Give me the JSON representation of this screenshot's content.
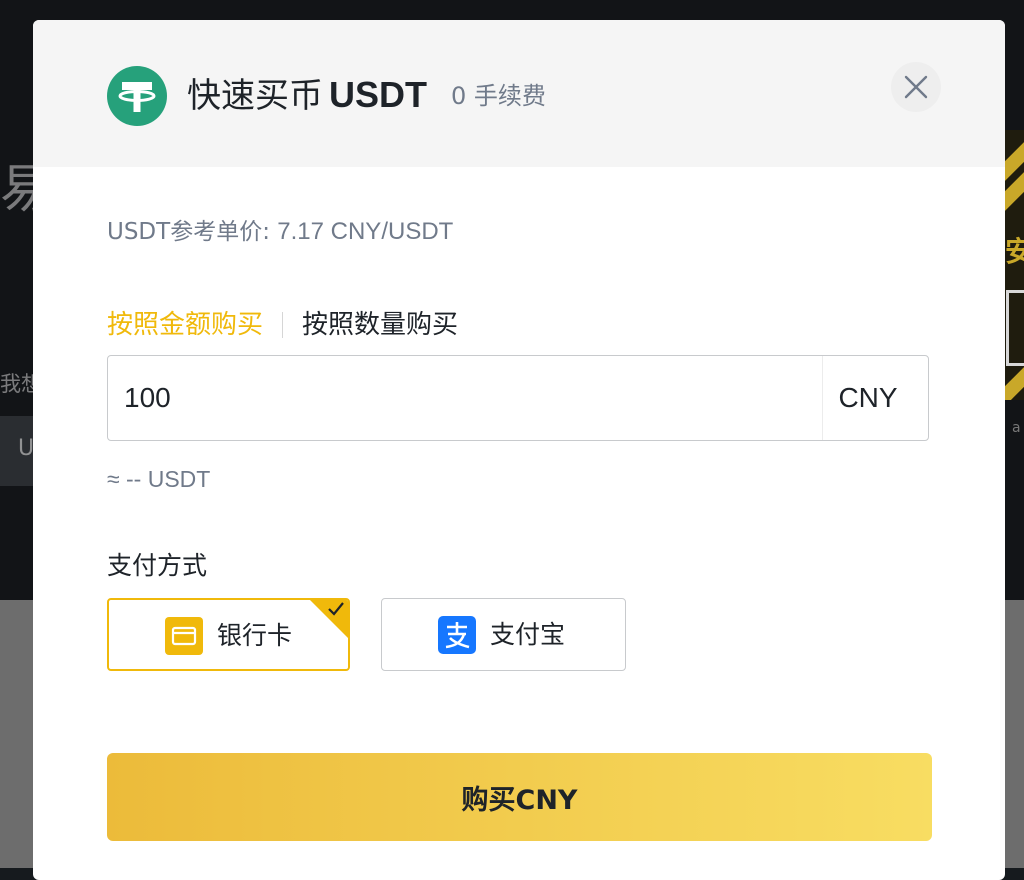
{
  "background": {
    "text_a": "易",
    "text_b": "我想",
    "text_c": "U",
    "banner_char": "安"
  },
  "modal": {
    "title_prefix": "快速买币",
    "title_ticker": "USDT",
    "fee_text": "0 手续费",
    "ref_price_label": "USDT参考单价:",
    "ref_price_value": "7.17 CNY/USDT",
    "tabs": [
      {
        "label": "按照金额购买",
        "active": true
      },
      {
        "label": "按照数量购买",
        "active": false
      }
    ],
    "amount_input": {
      "value": "100"
    },
    "amount_currency": "CNY",
    "approx_text": "≈ -- USDT",
    "payment_label": "支付方式",
    "payment_methods": [
      {
        "label": "银行卡",
        "icon": "bank-card-icon",
        "selected": true
      },
      {
        "label": "支付宝",
        "icon": "alipay-icon",
        "selected": false
      }
    ],
    "buy_button_label": "购买CNY"
  },
  "colors": {
    "accent": "#f0b90b",
    "tether_green": "#26a17b",
    "alipay_blue": "#1677ff",
    "text_primary": "#1e2329",
    "text_secondary": "#707a8a"
  }
}
